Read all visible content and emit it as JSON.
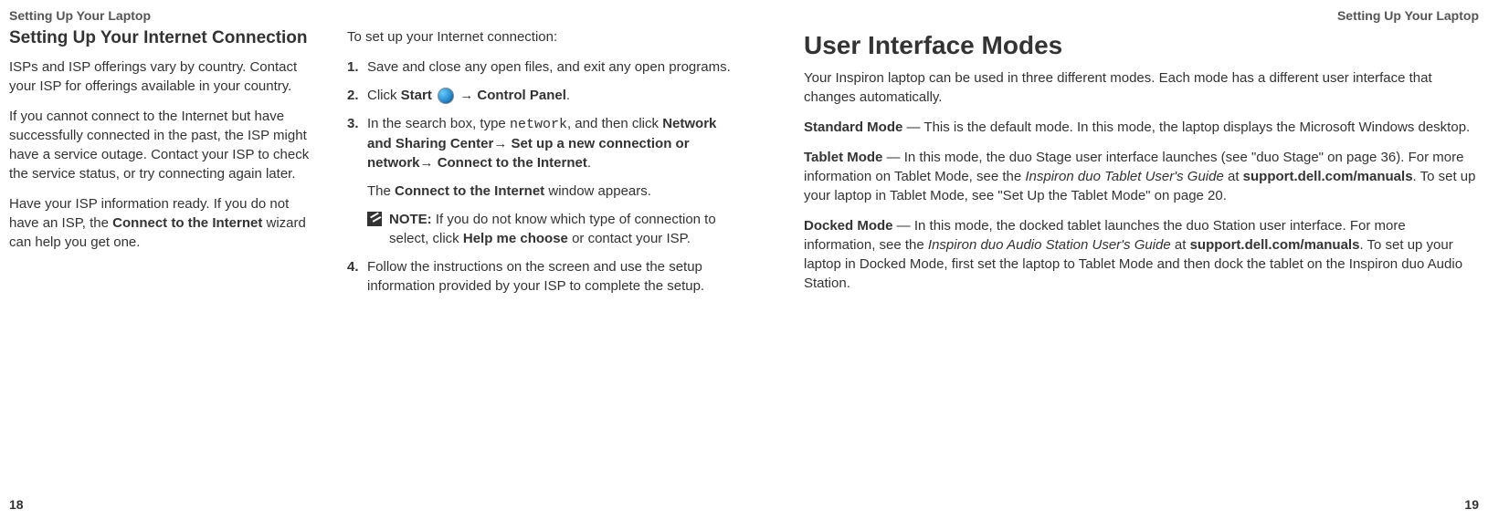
{
  "header": {
    "left": "Setting Up Your Laptop",
    "right": "Setting Up Your Laptop"
  },
  "pageNumbers": {
    "left": "18",
    "right": "19"
  },
  "col1": {
    "heading": "Setting Up Your Internet Connection",
    "p1": "ISPs and ISP offerings vary by country. Contact your ISP for offerings available in your country.",
    "p2": "If you cannot connect to the Internet but have successfully connected in the past, the ISP might have a service outage. Contact your ISP to check the service status, or try connecting again later.",
    "p3a": "Have your ISP information ready. If you do not have an ISP, the ",
    "p3b": "Connect to the Internet",
    "p3c": " wizard can help you get one."
  },
  "col2": {
    "intro": "To set up your Internet connection:",
    "s1n": "1.",
    "s1": "Save and close any open files, and exit any open programs.",
    "s2n": "2.",
    "s2a": "Click ",
    "s2b": "Start",
    "s2c": "→ ",
    "s2d": "Control Panel",
    "s2e": ".",
    "s3n": "3.",
    "s3a": "In the search box, type ",
    "s3b": "network",
    "s3c": ", and then click ",
    "s3d": "Network and Sharing Center",
    "s3e": "→ ",
    "s3f": "Set up a new connection or network",
    "s3g": "→ ",
    "s3h": "Connect to the Internet",
    "s3i": ".",
    "s3xa": "The ",
    "s3xb": "Connect to the Internet",
    "s3xc": " window appears.",
    "noteLabel": "NOTE:",
    "noteA": " If you do not know which type of connection to select, click ",
    "noteB": "Help me choose",
    "noteC": " or contact your ISP.",
    "s4n": "4.",
    "s4": "Follow the instructions on the screen and use the setup information provided by your ISP to complete the setup."
  },
  "col3": {
    "heading": "User Interface Modes",
    "p1": "Your Inspiron laptop can be used in three different modes. Each mode has a different user interface that changes automatically.",
    "stdLabel": "Standard Mode",
    "stdText": " — This is the default mode. In this mode, the laptop displays the Microsoft Windows desktop.",
    "tabLabel": "Tablet Mode",
    "tabA": " — In this mode, the duo Stage user interface launches (see \"duo Stage\" on page 36). For more information on Tablet Mode, see the ",
    "tabB": "Inspiron duo Tablet User's Guide",
    "tabC": " at ",
    "tabD": "support.dell.com/manuals",
    "tabE": ". To set up your laptop in Tablet Mode, see \"Set Up the Tablet Mode\" on page 20.",
    "dockLabel": "Docked Mode",
    "dockA": " — In this mode, the docked tablet launches the duo Station user interface. For more information, see the ",
    "dockB": "Inspiron duo Audio Station User's Guide",
    "dockC": " at ",
    "dockD": "support.dell.com/manuals",
    "dockE": ". To set up your laptop in Docked Mode, first set the laptop to Tablet Mode and then dock the tablet on the Inspiron duo Audio Station."
  }
}
